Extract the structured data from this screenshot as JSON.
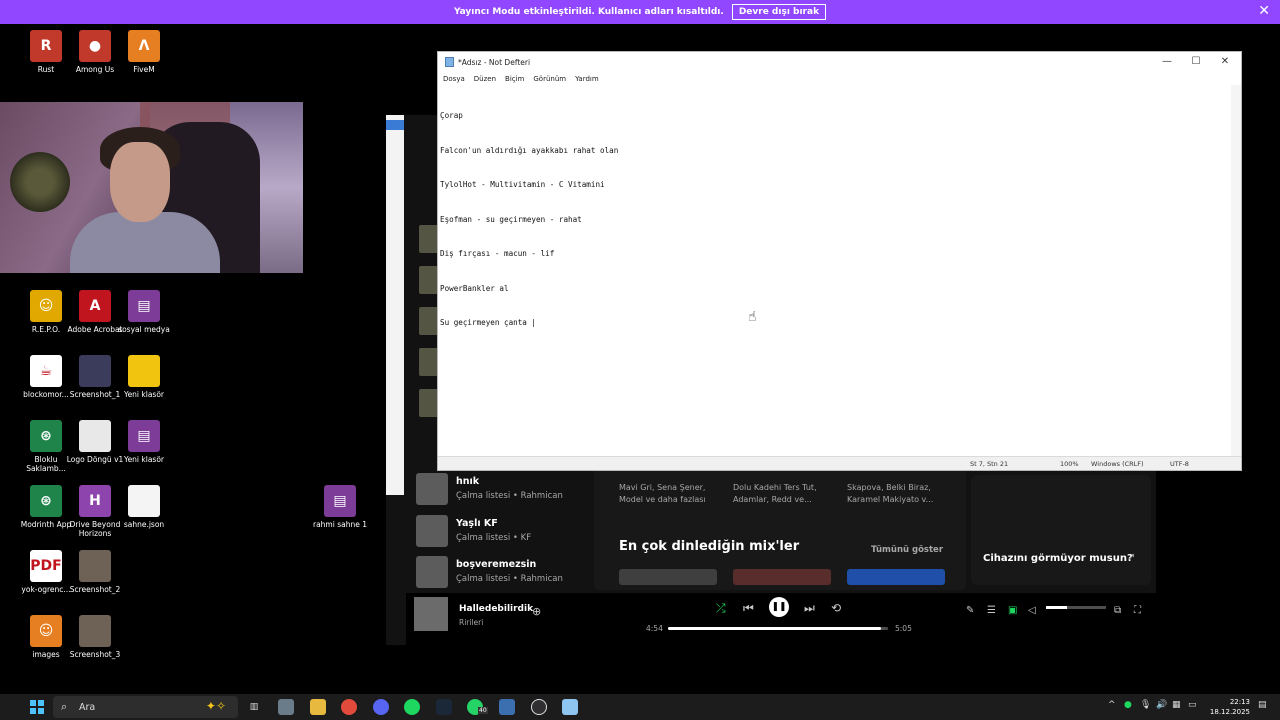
{
  "banner": {
    "message": "Yayıncı Modu etkinleştirildi. Kullanıcı adları kısaltıldı.",
    "button": "Devre dışı bırak",
    "close": "✕"
  },
  "desktop": {
    "icons": [
      {
        "label": "Rust",
        "color": "#c0392b",
        "glyph": "R"
      },
      {
        "label": "Among Us",
        "color": "#c0392b",
        "glyph": "●"
      },
      {
        "label": "FiveM",
        "color": "#e67e22",
        "glyph": "Λ"
      },
      {
        "label": "R.E.P.O.",
        "color": "#e0a800",
        "glyph": "☺"
      },
      {
        "label": "Adobe Acrobat",
        "color": "#c0141e",
        "glyph": "A"
      },
      {
        "label": "sosyal medya",
        "color": "#7d3c98",
        "glyph": "▤"
      },
      {
        "label": "blockomor...",
        "color": "#ffffff",
        "glyph": "☕"
      },
      {
        "label": "Screenshot_1",
        "color": "#3b3b5c",
        "glyph": ""
      },
      {
        "label": "Yeni klasör",
        "color": "#f1c40f",
        "glyph": ""
      },
      {
        "label": "Bloklu Saklamb...",
        "color": "#1e8449",
        "glyph": "⊛"
      },
      {
        "label": "Logo Döngü v1",
        "color": "#e8e8e8",
        "glyph": ""
      },
      {
        "label": "Yeni klasör",
        "color": "#7d3c98",
        "glyph": "▤"
      },
      {
        "label": "Modrinth App",
        "color": "#1e8449",
        "glyph": "⊛"
      },
      {
        "label": "Drive Beyond Horizons",
        "color": "#8e44ad",
        "glyph": "H"
      },
      {
        "label": "sahne.json",
        "color": "#f4f4f4",
        "glyph": ""
      },
      {
        "label": "yok-ogrenc...",
        "color": "#ffffff",
        "glyph": "PDF"
      },
      {
        "label": "Screenshot_2",
        "color": "#6e6257",
        "glyph": ""
      },
      {
        "label": "images",
        "color": "#e67e22",
        "glyph": "☺"
      },
      {
        "label": "Screenshot_3",
        "color": "#6e6257",
        "glyph": ""
      },
      {
        "label": "rahmi sahne 1",
        "color": "#7d3c98",
        "glyph": "▤"
      }
    ]
  },
  "spotify": {
    "playlists": [
      {
        "title": "hnık",
        "subtitle": "Çalma listesi • Rahmican"
      },
      {
        "title": "Yaşlı KF",
        "subtitle": "Çalma listesi • KF"
      },
      {
        "title": "boşveremezsin",
        "subtitle": "Çalma listesi • Rahmican"
      }
    ],
    "cards": [
      "Mavi Gri, Sena Şener,\nModel ve daha fazlası",
      "Dolu Kadehi Ters Tut,\nAdamlar, Redd ve...",
      "Skapova, Belki Biraz,\nKaramel Makiyato v..."
    ],
    "section_title": "En çok dinlediğin mix'ler",
    "show_all": "Tümünü göster",
    "device_prompt": "Cihazını görmüyor musun?",
    "now_playing": {
      "song": "Halledebilirdik",
      "artist": "Ririleri",
      "elapsed": "4:54",
      "duration": "5:05",
      "progress": 0.97,
      "volume": 0.35
    }
  },
  "notepad": {
    "title": "*Adsız - Not Defteri",
    "menu": [
      "Dosya",
      "Düzen",
      "Biçim",
      "Görünüm",
      "Yardım"
    ],
    "lines": [
      "Çorap",
      "Falcon'un aldırdığı ayakkabı rahat olan",
      "TylolHot - Multivitamin - C Vitamini",
      "Eşofman - su geçirmeyen - rahat",
      "Diş fırçası - macun - lif",
      "PowerBankler al",
      "Su geçirmeyen çanta |"
    ],
    "status": {
      "position": "St 7, Stn 21",
      "zoom": "100%",
      "line_ending": "Windows (CRLF)",
      "encoding": "UTF-8"
    }
  },
  "taskbar": {
    "search_placeholder": "Ara",
    "apps": [
      "task-view",
      "file-explorer",
      "chrome",
      "discord",
      "spotify",
      "steam",
      "whatsapp",
      "network",
      "obs",
      "notepad"
    ],
    "clock_time": "22:13",
    "clock_date": "18.12.2025",
    "whatsapp_badge": "40"
  }
}
